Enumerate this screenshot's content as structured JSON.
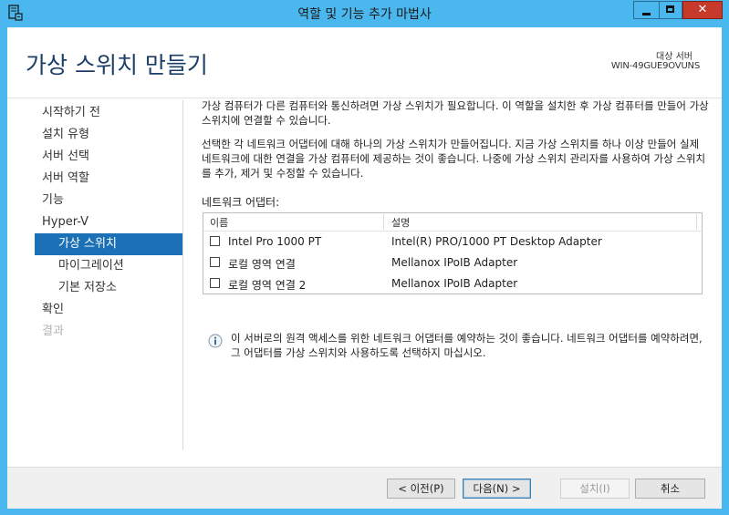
{
  "window": {
    "title": "역할 및 기능 추가 마법사"
  },
  "header": {
    "page_title": "가상 스위치 만들기",
    "destination_label": "대상 서버",
    "destination_server": "WIN-49GUE9OVUNS"
  },
  "nav": {
    "items": [
      {
        "label": "시작하기 전"
      },
      {
        "label": "설치 유형"
      },
      {
        "label": "서버 선택"
      },
      {
        "label": "서버 역할"
      },
      {
        "label": "기능"
      },
      {
        "label": "Hyper-V"
      },
      {
        "label": "가상 스위치"
      },
      {
        "label": "마이그레이션"
      },
      {
        "label": "기본 저장소"
      },
      {
        "label": "확인"
      },
      {
        "label": "결과"
      }
    ]
  },
  "content": {
    "paragraph1": "가상 컴퓨터가 다른 컴퓨터와 통신하려면 가상 스위치가 필요합니다. 이 역할을 설치한 후 가상 컴퓨터를 만들어 가상 스위치에 연결할 수 있습니다.",
    "paragraph2": "선택한 각 네트워크 어댑터에 대해 하나의 가상 스위치가 만들어집니다. 지금 가상 스위치를 하나 이상 만들어 실제 네트워크에 대한 연결을 가상 컴퓨터에 제공하는 것이 좋습니다. 나중에 가상 스위치 관리자를 사용하여 가상 스위치를 추가, 제거 및 수정할 수 있습니다.",
    "list_label": "네트워크 어댑터:",
    "columns": {
      "name": "이름",
      "description": "설명"
    },
    "adapters": [
      {
        "name": "Intel Pro 1000 PT",
        "description": "Intel(R) PRO/1000 PT Desktop Adapter",
        "checked": false
      },
      {
        "name": "로컬 영역 연결",
        "description": "Mellanox IPoIB Adapter",
        "checked": false
      },
      {
        "name": "로컬 영역 연결 2",
        "description": "Mellanox IPoIB Adapter",
        "checked": false
      }
    ],
    "info_text": "이 서버로의 원격 액세스를 위한 네트워크 어댑터를 예약하는 것이 좋습니다. 네트워크 어댑터를 예약하려면, 그 어댑터를 가상 스위치와 사용하도록 선택하지 마십시오."
  },
  "footer": {
    "prev_label": "< 이전(P)",
    "next_label": "다음(N) >",
    "install_label": "설치(I)",
    "cancel_label": "취소"
  },
  "colors": {
    "titlebar": "#4ab8ee",
    "selected_nav": "#1b70b6",
    "title_text": "#1b3d66",
    "close_button": "#c7392b"
  },
  "icons": [
    "server-manager-icon",
    "minimize-icon",
    "maximize-icon",
    "close-icon",
    "info-icon"
  ]
}
